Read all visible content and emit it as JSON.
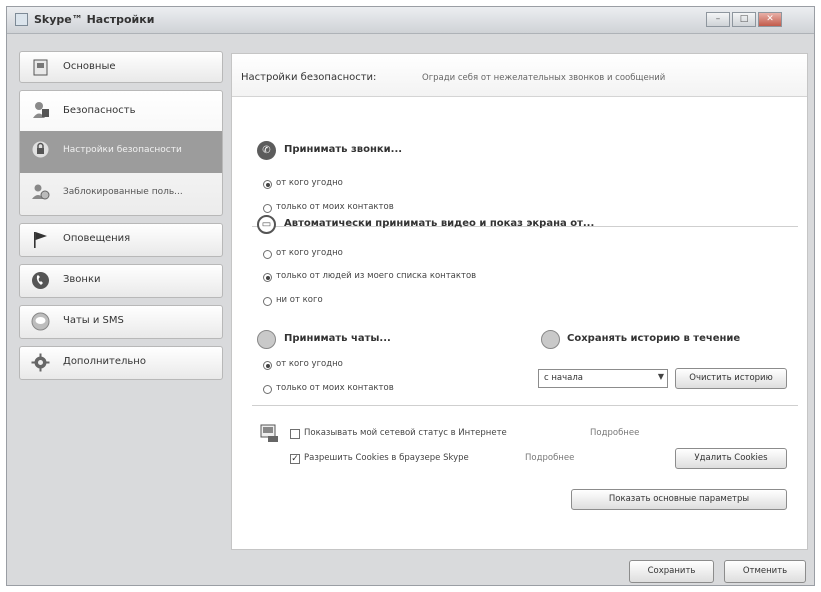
{
  "window": {
    "title": "Skype™ Настройки",
    "controls": {
      "minimize": "–",
      "maximize": "□",
      "close": "✕"
    }
  },
  "sidebar": {
    "items": [
      {
        "label": "Основные",
        "icon": "general-icon"
      },
      {
        "label": "Безопасность",
        "icon": "security-icon"
      },
      {
        "label": "Настройки безопасности",
        "icon": "lock-icon"
      },
      {
        "label": "Заблокированные поль...",
        "icon": "blocked-users-icon"
      },
      {
        "label": "Оповещения",
        "icon": "flag-icon"
      },
      {
        "label": "Звонки",
        "icon": "phone-icon"
      },
      {
        "label": "Чаты и SMS",
        "icon": "chat-icon"
      },
      {
        "label": "Дополнительно",
        "icon": "gear-icon"
      }
    ]
  },
  "panel": {
    "title": "Настройки безопасности:",
    "description": "Огради себя от нежелательных звонков и сообщений",
    "calls": {
      "title": "Принимать звонки...",
      "options": [
        "от кого угодно",
        "только от моих контактов"
      ],
      "selected": 0
    },
    "video": {
      "title": "Автоматически принимать видео и показ экрана от...",
      "options": [
        "от кого угодно",
        "только от людей из моего списка контактов",
        "ни от кого"
      ],
      "selected": 1
    },
    "chats": {
      "title": "Принимать чаты...",
      "options": [
        "от кого угодно",
        "только от моих контактов"
      ],
      "selected": 0
    },
    "history": {
      "title": "Сохранять историю в течение",
      "select_value": "с начала",
      "clear_button": "Очистить историю"
    },
    "status": {
      "show_status_label": "Показывать мой сетевой статус в Интернете",
      "show_status_checked": false,
      "show_status_more": "Подробнее",
      "cookies_label": "Разрешить Cookies в браузере Skype",
      "cookies_checked": true,
      "cookies_more": "Подробнее",
      "delete_cookies_button": "Удалить Cookies",
      "show_basic_button": "Показать основные параметры"
    }
  },
  "footer": {
    "save_button": "Сохранить",
    "cancel_button": "Отменить"
  }
}
